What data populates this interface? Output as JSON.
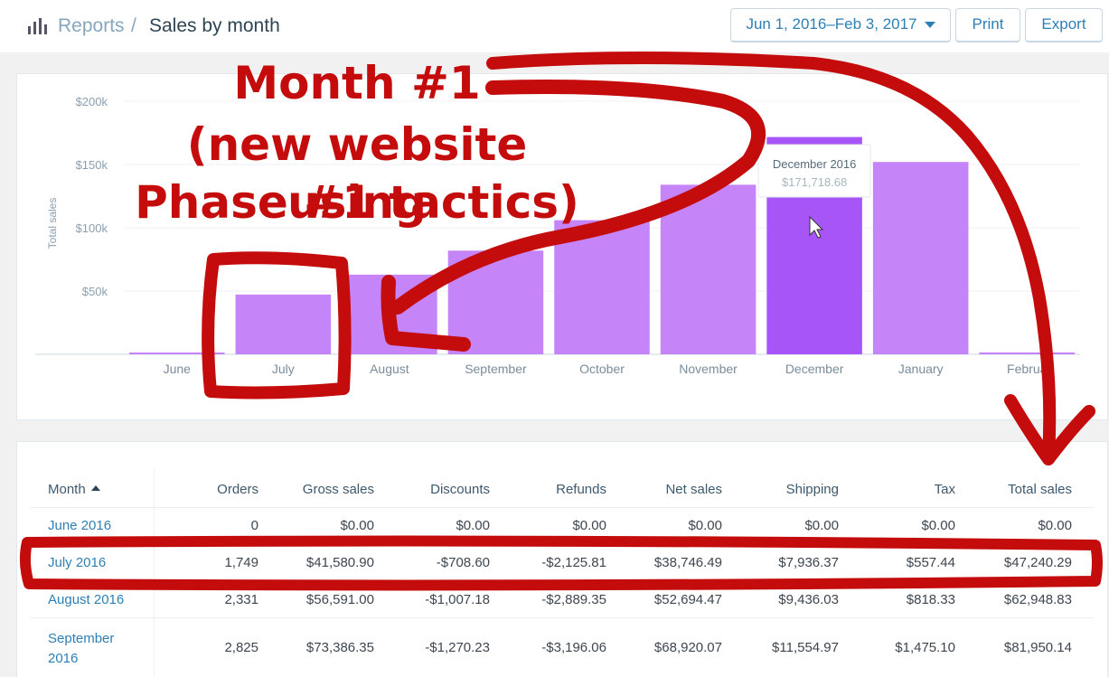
{
  "header": {
    "breadcrumb_root": "Reports",
    "breadcrumb_separator": "/",
    "page_title": "Sales by month",
    "date_range": "Jun 1, 2016–Feb 3, 2017",
    "print_label": "Print",
    "export_label": "Export",
    "icon": "bar-chart-icon"
  },
  "colors": {
    "bar": "#c584f7",
    "bar_highlight": "#a855f7",
    "link": "#2e7fb4",
    "annotation": "#c40c0c"
  },
  "chart_data": {
    "type": "bar",
    "ylabel": "Total sales",
    "categories": [
      "June",
      "July",
      "August",
      "September",
      "October",
      "November",
      "December",
      "January",
      "February"
    ],
    "category_labels": [
      "June",
      "July",
      "August",
      "September",
      "October",
      "November",
      "December",
      "January",
      "Februa"
    ],
    "values": [
      0,
      47240.29,
      62948.83,
      81950.14,
      106000,
      134000,
      171718.68,
      152000,
      1500
    ],
    "yticks": [
      "$50k",
      "$100k",
      "$150k",
      "$200k"
    ],
    "ytick_values": [
      50000,
      100000,
      150000,
      200000
    ],
    "ylim": [
      0,
      200000
    ],
    "highlight_index": 6,
    "grid": true,
    "tooltip": {
      "title": "December 2016",
      "value": "$171,718.68"
    }
  },
  "annotation": {
    "lines": [
      "Month #1",
      "(new website using",
      "Phase #1 tactics)"
    ]
  },
  "table": {
    "columns": [
      "Month",
      "Orders",
      "Gross sales",
      "Discounts",
      "Refunds",
      "Net sales",
      "Shipping",
      "Tax",
      "Total sales"
    ],
    "rows": [
      {
        "month": "June 2016",
        "orders": "0",
        "gross": "$0.00",
        "discounts": "$0.00",
        "refunds": "$0.00",
        "net": "$0.00",
        "shipping": "$0.00",
        "tax": "$0.00",
        "total": "$0.00"
      },
      {
        "month": "July 2016",
        "orders": "1,749",
        "gross": "$41,580.90",
        "discounts": "-$708.60",
        "refunds": "-$2,125.81",
        "net": "$38,746.49",
        "shipping": "$7,936.37",
        "tax": "$557.44",
        "total": "$47,240.29"
      },
      {
        "month": "August 2016",
        "orders": "2,331",
        "gross": "$56,591.00",
        "discounts": "-$1,007.18",
        "refunds": "-$2,889.35",
        "net": "$52,694.47",
        "shipping": "$9,436.03",
        "tax": "$818.33",
        "total": "$62,948.83"
      },
      {
        "month": "September 2016",
        "orders": "2,825",
        "gross": "$73,386.35",
        "discounts": "-$1,270.23",
        "refunds": "-$3,196.06",
        "net": "$68,920.07",
        "shipping": "$11,554.97",
        "tax": "$1,475.10",
        "total": "$81,950.14"
      }
    ]
  }
}
